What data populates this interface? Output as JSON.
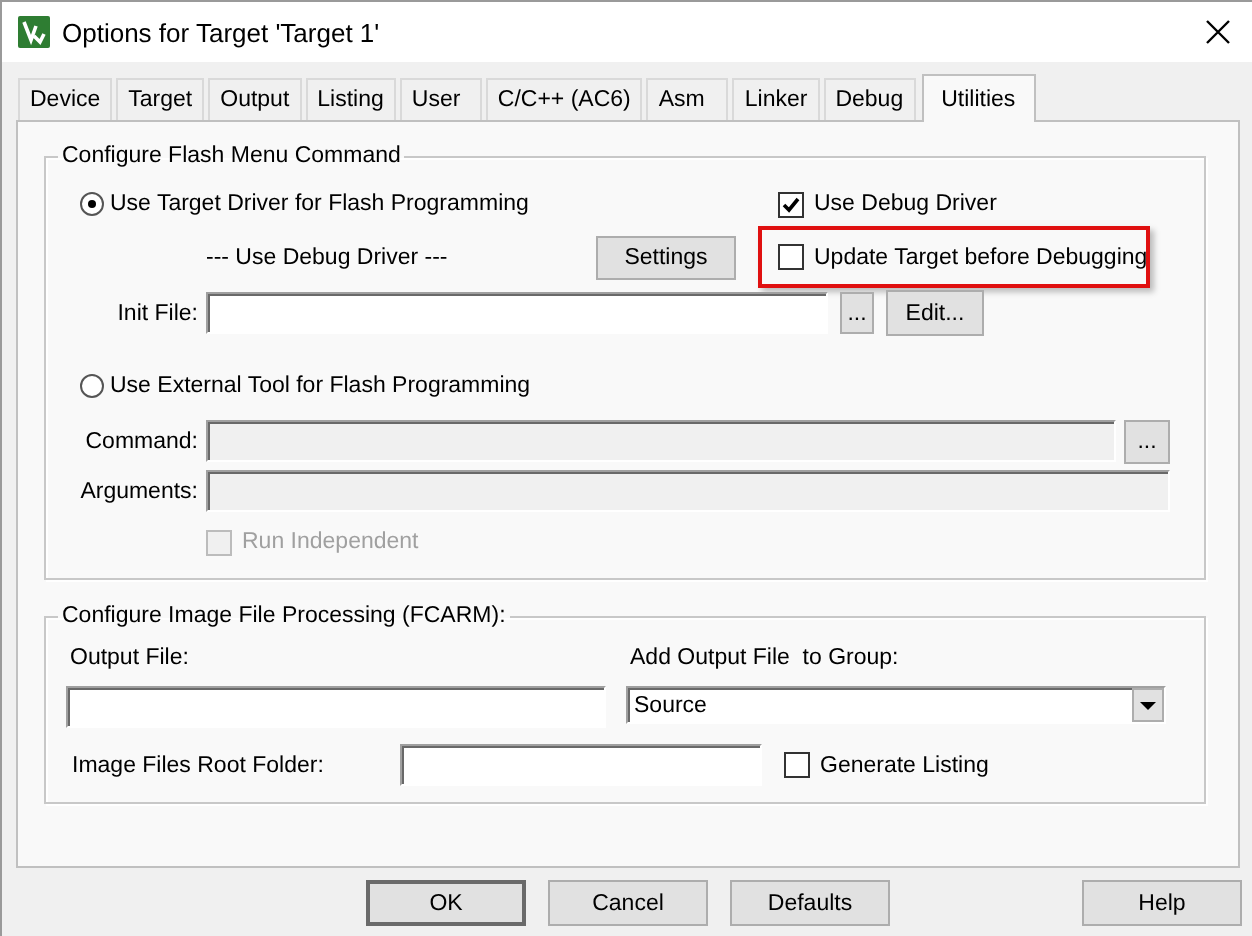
{
  "window": {
    "title": "Options for Target 'Target 1'"
  },
  "tabs": [
    {
      "label": "Device",
      "selected": false
    },
    {
      "label": "Target",
      "selected": false
    },
    {
      "label": "Output",
      "selected": false
    },
    {
      "label": "Listing",
      "selected": false
    },
    {
      "label": "User",
      "selected": false
    },
    {
      "label": "C/C++ (AC6)",
      "selected": false
    },
    {
      "label": "Asm",
      "selected": false
    },
    {
      "label": "Linker",
      "selected": false
    },
    {
      "label": "Debug",
      "selected": false
    },
    {
      "label": "Utilities",
      "selected": true
    }
  ],
  "flash_group": {
    "title": "Configure Flash Menu Command",
    "target_driver": {
      "label": "Use Target Driver for Flash Programming",
      "selected": true
    },
    "use_debug_driver": {
      "label": "Use Debug Driver",
      "checked": true
    },
    "driver_caption": "--- Use Debug Driver ---",
    "settings_button": "Settings",
    "update_target": {
      "label": "Update Target before Debugging",
      "checked": false,
      "highlighted": true
    },
    "init_file": {
      "label": "Init File:",
      "browse": "...",
      "edit": "Edit..."
    },
    "external_tool": {
      "label": "Use External Tool for Flash Programming",
      "selected": false
    },
    "command": {
      "label": "Command:",
      "disabled": true,
      "browse": "..."
    },
    "arguments": {
      "label": "Arguments:",
      "disabled": true
    },
    "run_independent": {
      "label": "Run Independent",
      "checked": false,
      "disabled": true
    }
  },
  "image_group": {
    "title": "Configure Image File Processing (FCARM):",
    "output_file": {
      "label": "Output File:"
    },
    "add_to_group": {
      "label": "Add Output File  to Group:",
      "value": "Source"
    },
    "root_folder": {
      "label": "Image Files Root Folder:"
    },
    "generate_listing": {
      "label": "Generate Listing",
      "checked": false
    }
  },
  "buttons": [
    {
      "label": "OK",
      "default": true
    },
    {
      "label": "Cancel",
      "default": false
    },
    {
      "label": "Defaults",
      "default": false
    }
  ],
  "help_button": "Help"
}
